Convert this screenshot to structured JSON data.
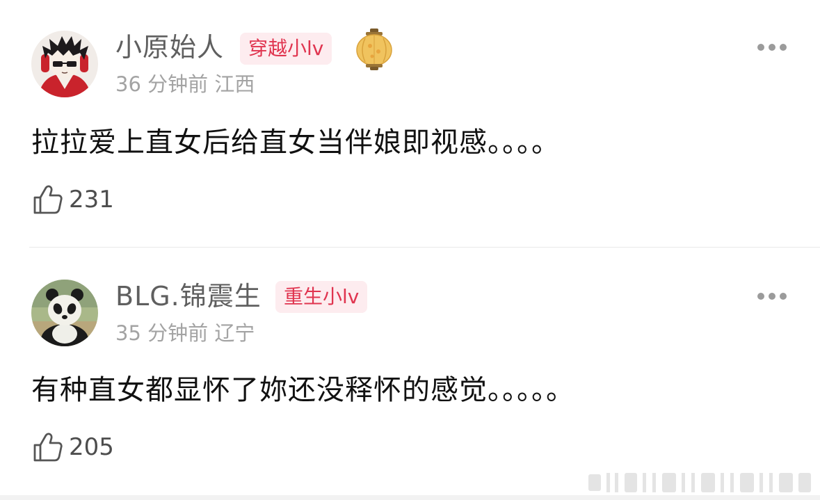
{
  "comments": [
    {
      "username": "小原始人",
      "badge": "穿越小lv",
      "has_lantern": true,
      "time": "36 分钟前",
      "location": "江西",
      "text": "拉拉爱上直女后给直女当伴娘即视感。。。。",
      "likes": "231",
      "avatar": "cartoon-avatar"
    },
    {
      "username": "BLG.锦震生",
      "badge": "重生小lv",
      "has_lantern": false,
      "time": "35 分钟前",
      "location": "辽宁",
      "text": "有种直女都显怀了妳还没释怀的感觉。。。。。",
      "likes": "205",
      "avatar": "panda-avatar"
    }
  ],
  "colors": {
    "badge_text": "#e0344f",
    "badge_bg": "#fdecef",
    "username": "#5f5f5f",
    "meta": "#a3a3a3",
    "body_text": "#111111"
  },
  "icons": [
    "more-icon",
    "thumbs-up-icon",
    "lantern-icon"
  ]
}
